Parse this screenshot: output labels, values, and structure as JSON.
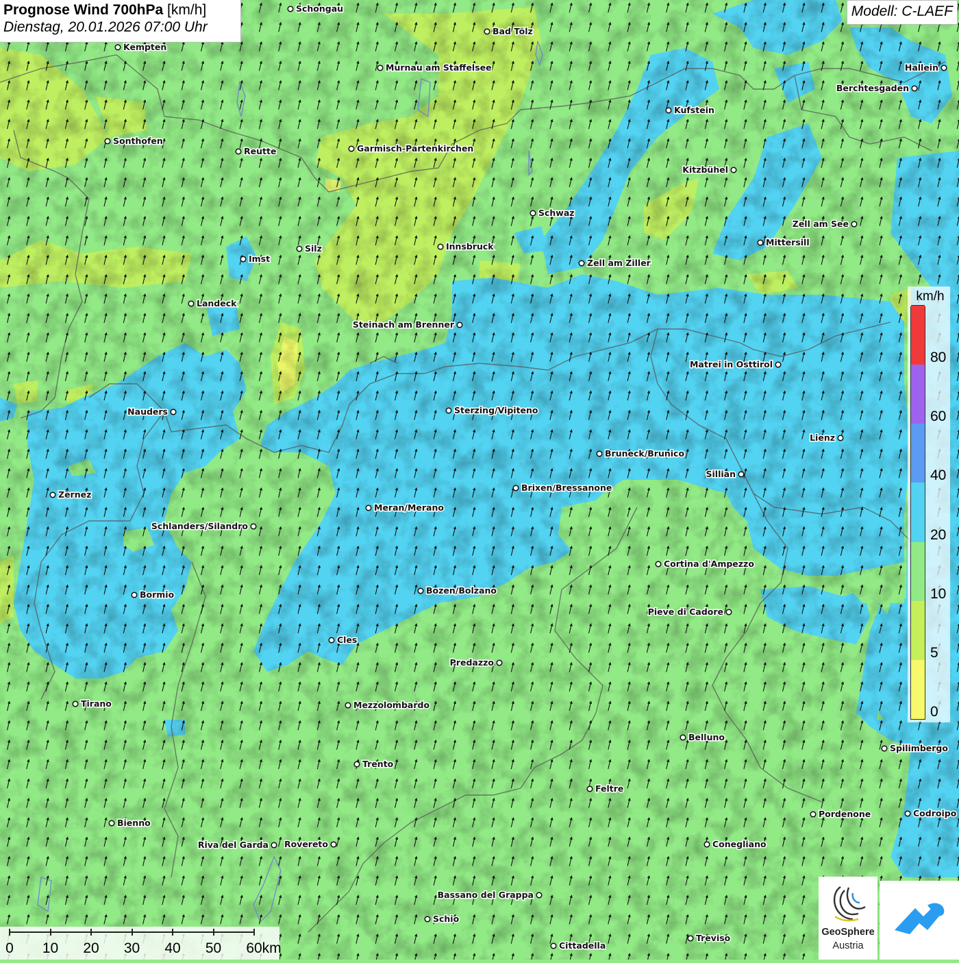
{
  "header": {
    "title_main": "Prognose Wind 700hPa",
    "title_unit": "[km/h]",
    "subtitle": "Dienstag, 20.01.2026 07:00 Uhr",
    "model": "Modell: C-LAEF"
  },
  "legend": {
    "unit": "km/h",
    "bins": [
      {
        "from": 0,
        "to": 5,
        "color": "#f6f96a"
      },
      {
        "from": 5,
        "to": 10,
        "color": "#c6f05a"
      },
      {
        "from": 10,
        "to": 20,
        "color": "#92ea86"
      },
      {
        "from": 20,
        "to": 40,
        "color": "#53d3f2"
      },
      {
        "from": 40,
        "to": 60,
        "color": "#5c9bf3"
      },
      {
        "from": 60,
        "to": 80,
        "color": "#9e63ee"
      },
      {
        "from": 80,
        "to": 100,
        "color": "#f03a3a"
      }
    ],
    "tick_labels": [
      "0",
      "5",
      "10",
      "20",
      "40",
      "60",
      "80"
    ]
  },
  "wind": {
    "predominant_direction": "southwest",
    "arrow_color": "#111111",
    "arrow_icon": "wind-arrow-icon"
  },
  "scalebar": {
    "labels": [
      "0",
      "10",
      "20",
      "30",
      "40",
      "50",
      "60km"
    ]
  },
  "logos": {
    "geosphere_line1": "GeoSphere",
    "geosphere_line2": "Austria"
  },
  "cities": [
    {
      "name": "Schongau"
    },
    {
      "name": "Bad Tölz"
    },
    {
      "name": "Kempten"
    },
    {
      "name": "Murnau am Staffelsee"
    },
    {
      "name": "Hallein"
    },
    {
      "name": "Berchtesgaden"
    },
    {
      "name": "Kufstein"
    },
    {
      "name": "Sonthofen"
    },
    {
      "name": "Reutte"
    },
    {
      "name": "Garmisch-Partenkirchen"
    },
    {
      "name": "Kitzbühel"
    },
    {
      "name": "Schwaz"
    },
    {
      "name": "Zell am See"
    },
    {
      "name": "Mittersill"
    },
    {
      "name": "Innsbruck"
    },
    {
      "name": "Silz"
    },
    {
      "name": "Imst"
    },
    {
      "name": "Zell am Ziller"
    },
    {
      "name": "Landeck"
    },
    {
      "name": "Steinach am Brenner"
    },
    {
      "name": "Matrei in Osttirol"
    },
    {
      "name": "Nauders"
    },
    {
      "name": "Sterzing/Vipiteno"
    },
    {
      "name": "Lienz"
    },
    {
      "name": "Bruneck/Brunico"
    },
    {
      "name": "Sillian"
    },
    {
      "name": "Zernez"
    },
    {
      "name": "Brixen/Bressanone"
    },
    {
      "name": "Meran/Merano"
    },
    {
      "name": "Schlanders/Silandro"
    },
    {
      "name": "Cortina d'Ampezzo"
    },
    {
      "name": "Bozen/Bolzano"
    },
    {
      "name": "Bormio"
    },
    {
      "name": "Pieve di Cadore"
    },
    {
      "name": "Cles"
    },
    {
      "name": "Predazzo"
    },
    {
      "name": "Tirano"
    },
    {
      "name": "Mezzolombardo"
    },
    {
      "name": "Belluno"
    },
    {
      "name": "Spilimbergo"
    },
    {
      "name": "Trento"
    },
    {
      "name": "Feltre"
    },
    {
      "name": "Pordenone"
    },
    {
      "name": "Codroipo"
    },
    {
      "name": "Bienno"
    },
    {
      "name": "Riva del Garda"
    },
    {
      "name": "Rovereto"
    },
    {
      "name": "Conegliano"
    },
    {
      "name": "Bassano del Grappa"
    },
    {
      "name": "Schio"
    },
    {
      "name": "Treviso"
    },
    {
      "name": "Cittadella"
    }
  ]
}
